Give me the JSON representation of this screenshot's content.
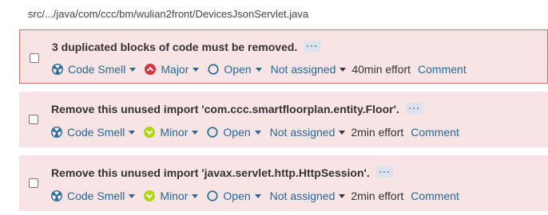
{
  "file_path": "src/.../java/com/ccc/bm/wulian2front/DevicesJsonServlet.java",
  "issues": [
    {
      "message": "3 duplicated blocks of code must be removed.",
      "type": "Code Smell",
      "severity": "Major",
      "status": "Open",
      "assignee": "Not assigned",
      "effort": "40min effort",
      "comment": "Comment",
      "severity_color": "#d4333f"
    },
    {
      "message": "Remove this unused import 'com.ccc.smartfloorplan.entity.Floor'.",
      "type": "Code Smell",
      "severity": "Minor",
      "status": "Open",
      "assignee": "Not assigned",
      "effort": "2min effort",
      "comment": "Comment",
      "severity_color": "#b0d513"
    },
    {
      "message": "Remove this unused import 'javax.servlet.http.HttpSession'.",
      "type": "Code Smell",
      "severity": "Minor",
      "status": "Open",
      "assignee": "Not assigned",
      "effort": "2min effort",
      "comment": "Comment",
      "severity_color": "#b0d513"
    }
  ],
  "icons": {
    "type": "code-smell-icon",
    "major": "major-severity-icon",
    "minor": "minor-severity-icon",
    "status": "open-status-icon",
    "more": "more-options-icon"
  }
}
